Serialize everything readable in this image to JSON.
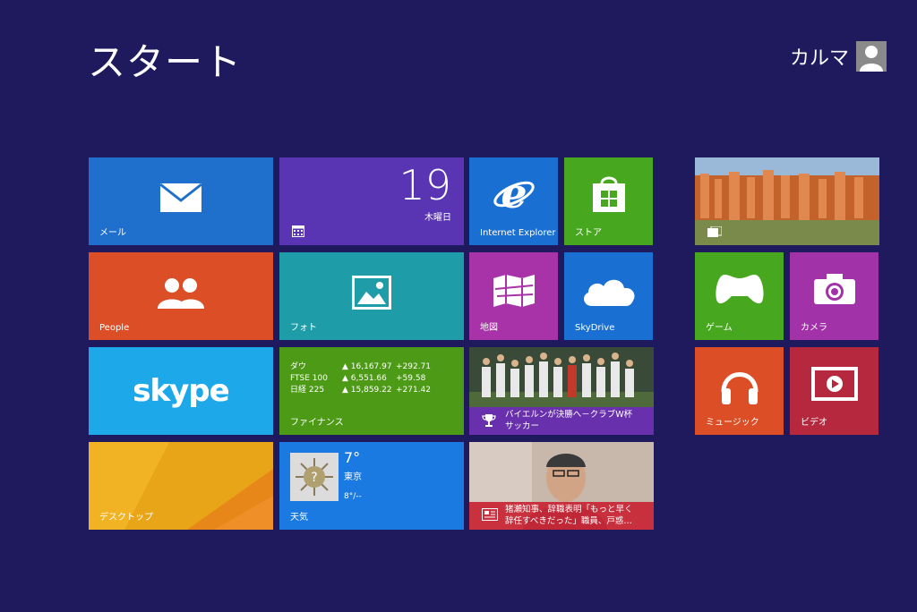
{
  "header": {
    "title": "スタート",
    "user_name": "カルマ"
  },
  "tiles": {
    "mail": "メール",
    "people": "People",
    "skype": "skype",
    "desktop": "デスクトップ",
    "calendar": {
      "day": "19",
      "weekday": "木曜日"
    },
    "photo": "フォト",
    "finance": {
      "label": "ファイナンス",
      "rows": [
        {
          "name": "ダウ",
          "value": "▲ 16,167.97",
          "change": "+292.71"
        },
        {
          "name": "FTSE 100",
          "value": "▲ 6,551.66",
          "change": "+59.58"
        },
        {
          "name": "日経 225",
          "value": "▲ 15,859.22",
          "change": "+271.42"
        }
      ]
    },
    "weather": {
      "label": "天気",
      "temp": "7°",
      "city": "東京",
      "range": "8°/--"
    },
    "ie": "Internet Explorer",
    "store": "ストア",
    "map": "地図",
    "skydrive": "SkyDrive",
    "sports": {
      "line1": "バイエルンが決勝へ－クラブW杯",
      "line2": "サッカー"
    },
    "news": {
      "line1": "猪瀬知事、辞職表明「もっと早く",
      "line2": "辞任すべきだった」職員、戸惑…"
    },
    "game": "ゲーム",
    "camera": "カメラ",
    "music": "ミュージック",
    "video": "ビデオ"
  },
  "colors": {
    "background": "#1f1a5e",
    "mail": "#1f6fcd",
    "people": "#dc4e26",
    "skype": "#1da8ea",
    "calendar": "#5a35b3",
    "photo": "#1e9ca8",
    "finance": "#4d9a16",
    "store": "#47a81f",
    "map": "#a832a8",
    "video": "#b6283d"
  },
  "icons": [
    "envelope-icon",
    "people-icon",
    "skype-logo",
    "calendar-icon",
    "picture-icon",
    "ie-logo",
    "store-bag-icon",
    "map-icon",
    "cloud-icon",
    "trophy-icon",
    "newspaper-icon",
    "gamepad-icon",
    "camera-icon",
    "headphones-icon",
    "video-play-icon",
    "user-avatar-icon"
  ]
}
